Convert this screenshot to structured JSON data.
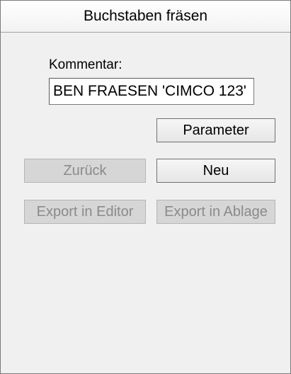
{
  "window": {
    "title": "Buchstaben fräsen"
  },
  "comment": {
    "label": "Kommentar:",
    "value": "BEN FRAESEN 'CIMCO 123'"
  },
  "buttons": {
    "parameter": "Parameter",
    "back": "Zurück",
    "new": "Neu",
    "export_editor": "Export in Editor",
    "export_clipboard": "Export in Ablage"
  }
}
